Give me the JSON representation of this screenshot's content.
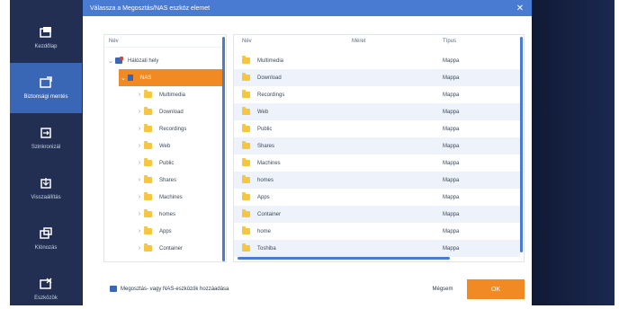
{
  "nav": {
    "items": [
      {
        "label": "Kezdőlap",
        "icon": "home-icon",
        "active": false
      },
      {
        "label": "Biztonsági mentés",
        "icon": "backup-icon",
        "active": true
      },
      {
        "label": "Szinkronizál",
        "icon": "sync-icon",
        "active": false
      },
      {
        "label": "Visszaállítás",
        "icon": "restore-icon",
        "active": false
      },
      {
        "label": "Klónozás",
        "icon": "clone-icon",
        "active": false
      },
      {
        "label": "Eszközök",
        "icon": "tools-icon",
        "active": false
      }
    ]
  },
  "dialog": {
    "title": "Válassza a Megosztás/NAS eszköz elemet",
    "close_glyph": "✕",
    "tree": {
      "header": "Név",
      "root_label": "Hálózati hely",
      "nas_label": "NAS",
      "folders": [
        "Multimedia",
        "Download",
        "Recordings",
        "Web",
        "Public",
        "Shares",
        "Machines",
        "homes",
        "Apps",
        "Container"
      ]
    },
    "list": {
      "columns": {
        "name": "Név",
        "size": "Méret",
        "type": "Típus"
      },
      "rows": [
        {
          "name": "Multimedia",
          "type": "Mappa"
        },
        {
          "name": "Download",
          "type": "Mappa"
        },
        {
          "name": "Recordings",
          "type": "Mappa"
        },
        {
          "name": "Web",
          "type": "Mappa"
        },
        {
          "name": "Public",
          "type": "Mappa"
        },
        {
          "name": "Shares",
          "type": "Mappa"
        },
        {
          "name": "Machines",
          "type": "Mappa"
        },
        {
          "name": "homes",
          "type": "Mappa"
        },
        {
          "name": "Apps",
          "type": "Mappa"
        },
        {
          "name": "Container",
          "type": "Mappa"
        },
        {
          "name": "home",
          "type": "Mappa"
        },
        {
          "name": "Toshiba",
          "type": "Mappa"
        }
      ]
    },
    "footer": {
      "add_link": "Megosztás- vagy NAS-eszközök hozzáadása",
      "cancel": "Mégsem",
      "ok": "OK"
    }
  },
  "colors": {
    "accent": "#4a7bd3",
    "orange": "#f28a24",
    "nav_bg": "#222f52",
    "folder": "#f7c640"
  }
}
